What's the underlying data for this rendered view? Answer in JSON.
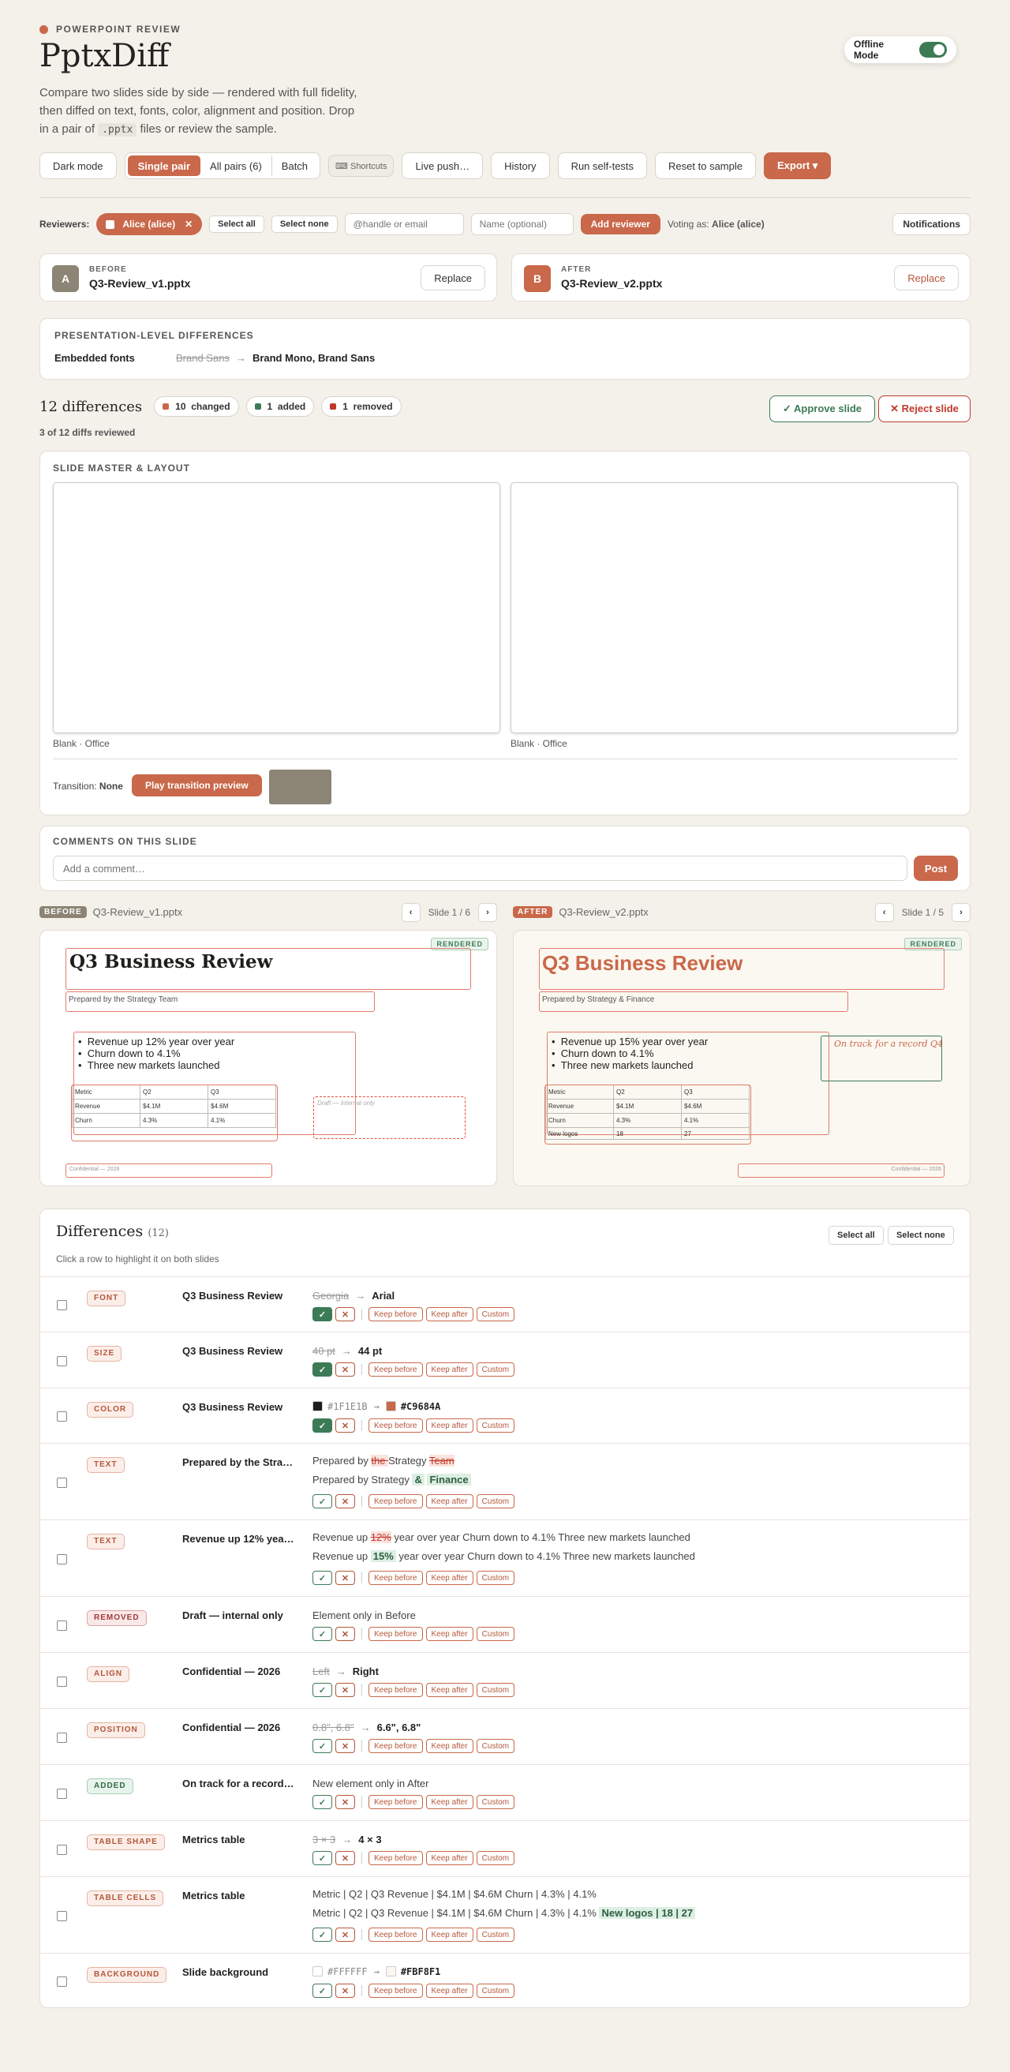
{
  "brand": {
    "kicker": "POWERPOINT REVIEW",
    "title": "PptxDiff",
    "desc_a": "Compare two slides side by side — rendered with full fidelity, then diffed on text, fonts, color, alignment and position. Drop in a pair of ",
    "desc_code": ".pptx",
    "desc_b": " files or review the sample."
  },
  "offline": {
    "label": "Offline Mode",
    "on": true
  },
  "toolbar": {
    "dark": "Dark mode",
    "single": "Single pair",
    "all": "All pairs (6)",
    "batch": "Batch",
    "shortcuts": "⌨ Shortcuts",
    "push": "Live push…",
    "history": "History",
    "tests": "Run self-tests",
    "reset": "Reset to sample",
    "export": "Export ▾"
  },
  "reviewers": {
    "label": "Reviewers:",
    "chip": "Alice (alice)",
    "select_all": "Select all",
    "select_none": "Select none",
    "handle_ph": "@handle or email",
    "name_ph": "Name (optional)",
    "add": "Add reviewer",
    "voting_prefix": "Voting as:",
    "voting_name": "Alice (alice)",
    "notifications": "Notifications"
  },
  "files": {
    "before_badge": "A",
    "before_label": "BEFORE",
    "before_name": "Q3-Review_v1.pptx",
    "after_badge": "B",
    "after_label": "AFTER",
    "after_name": "Q3-Review_v2.pptx",
    "replace": "Replace"
  },
  "pres": {
    "title": "PRESENTATION-LEVEL DIFFERENCES",
    "key": "Embedded fonts",
    "old": "Brand Sans",
    "new": "Brand Mono, Brand Sans"
  },
  "summary": {
    "count": "12 differences",
    "changed_n": "10",
    "changed": "changed",
    "added_n": "1",
    "added": "added",
    "removed_n": "1",
    "removed": "removed",
    "reviewed": "3 of 12 diffs reviewed",
    "approve": "✓ Approve slide",
    "reject": "✕ Reject slide",
    "colors": {
      "changed": "#c9684a",
      "added": "#3d7a56",
      "removed": "#c0392b"
    }
  },
  "master": {
    "title": "SLIDE MASTER & LAYOUT",
    "left_cap": "Blank · Office",
    "right_cap": "Blank · Office",
    "transition_label": "Transition:",
    "transition_value": "None",
    "play": "Play transition preview"
  },
  "comments": {
    "title": "COMMENTS ON THIS SLIDE",
    "placeholder": "Add a comment…",
    "post": "Post"
  },
  "viewer": {
    "before": {
      "badge": "BEFORE",
      "file": "Q3-Review_v1.pptx",
      "slide": "Slide 1 / 6",
      "rendered": "RENDERED",
      "title": "Q3 Business Review",
      "subtitle": "Prepared by the Strategy Team",
      "bullets": [
        "Revenue up 12% year over year",
        "Churn down to 4.1%",
        "Three new markets launched"
      ],
      "table": [
        [
          "Metric",
          "Q2",
          "Q3"
        ],
        [
          "Revenue",
          "$4.1M",
          "$4.6M"
        ],
        [
          "Churn",
          "4.3%",
          "4.1%"
        ]
      ],
      "draft": "Draft — internal only",
      "footer": "Confidential — 2026"
    },
    "after": {
      "badge": "AFTER",
      "file": "Q3-Review_v2.pptx",
      "slide": "Slide 1 / 5",
      "rendered": "RENDERED",
      "title": "Q3 Business Review",
      "subtitle": "Prepared by Strategy & Finance",
      "bullets": [
        "Revenue up 15% year over year",
        "Churn down to 4.1%",
        "Three new markets launched"
      ],
      "table": [
        [
          "Metric",
          "Q2",
          "Q3"
        ],
        [
          "Revenue",
          "$4.1M",
          "$4.6M"
        ],
        [
          "Churn",
          "4.3%",
          "4.1%"
        ],
        [
          "New logos",
          "18",
          "27"
        ]
      ],
      "note": "On track for a record Q4",
      "footer": "Confidential — 2026"
    }
  },
  "diffs": {
    "title": "Differences",
    "count": "(12)",
    "hint": "Click a row to highlight it on both slides",
    "select_all": "Select all",
    "select_none": "Select none",
    "actions": {
      "approve": "✓",
      "reject": "✕",
      "keep_before": "Keep before",
      "keep_after": "Keep after",
      "custom": "Custom"
    },
    "rows": [
      {
        "type": "FONT",
        "element": "Q3 Business Review",
        "old": "Georgia",
        "new": "Arial",
        "approved": true
      },
      {
        "type": "SIZE",
        "element": "Q3 Business Review",
        "old": "40 pt",
        "new": "44 pt",
        "approved": true
      },
      {
        "type": "COLOR",
        "element": "Q3 Business Review",
        "old": "#1F1E1B",
        "new": "#C9684A",
        "old_color": "#1F1E1B",
        "new_color": "#C9684A",
        "approved": true
      },
      {
        "type": "TEXT",
        "element": "Prepared by the Stra…",
        "l1a": "Prepared by ",
        "l1del": "the ",
        "l1b": "Strategy ",
        "l1del2": "Team",
        "l2a": "Prepared by Strategy ",
        "l2ins": "&",
        "l2b": " ",
        "l2ins2": "Finance"
      },
      {
        "type": "TEXT",
        "element": "Revenue up 12% yea…",
        "l1a": "Revenue up ",
        "l1del": "12%",
        "l1b": " year over year Churn down to 4.1% Three new markets launched",
        "l2a": "Revenue up ",
        "l2ins": "15%",
        "l2b": " year over year Churn down to 4.1% Three new markets launched"
      },
      {
        "type": "REMOVED",
        "element": "Draft — internal only",
        "note": "Element only in Before"
      },
      {
        "type": "ALIGN",
        "element": "Confidential — 2026",
        "old": "Left",
        "new": "Right"
      },
      {
        "type": "POSITION",
        "element": "Confidential — 2026",
        "old": "0.8\", 6.8\"",
        "new": "6.6\", 6.8\""
      },
      {
        "type": "ADDED",
        "element": "On track for a record…",
        "note": "New element only in After"
      },
      {
        "type": "TABLE SHAPE",
        "element": "Metrics table",
        "old": "3 × 3",
        "new": "4 × 3"
      },
      {
        "type": "TABLE CELLS",
        "element": "Metrics table",
        "l1": "Metric | Q2 | Q3 Revenue | $4.1M | $4.6M Churn | 4.3% | 4.1%",
        "l2": "Metric | Q2 | Q3 Revenue | $4.1M | $4.6M Churn | 4.3% | 4.1% ",
        "l2ins": "New  logos  |  18  |  27"
      },
      {
        "type": "BACKGROUND",
        "element": "Slide background",
        "old": "#FFFFFF",
        "new": "#FBF8F1",
        "old_color": "#FFFFFF",
        "new_color": "#FBF8F1"
      }
    ]
  }
}
